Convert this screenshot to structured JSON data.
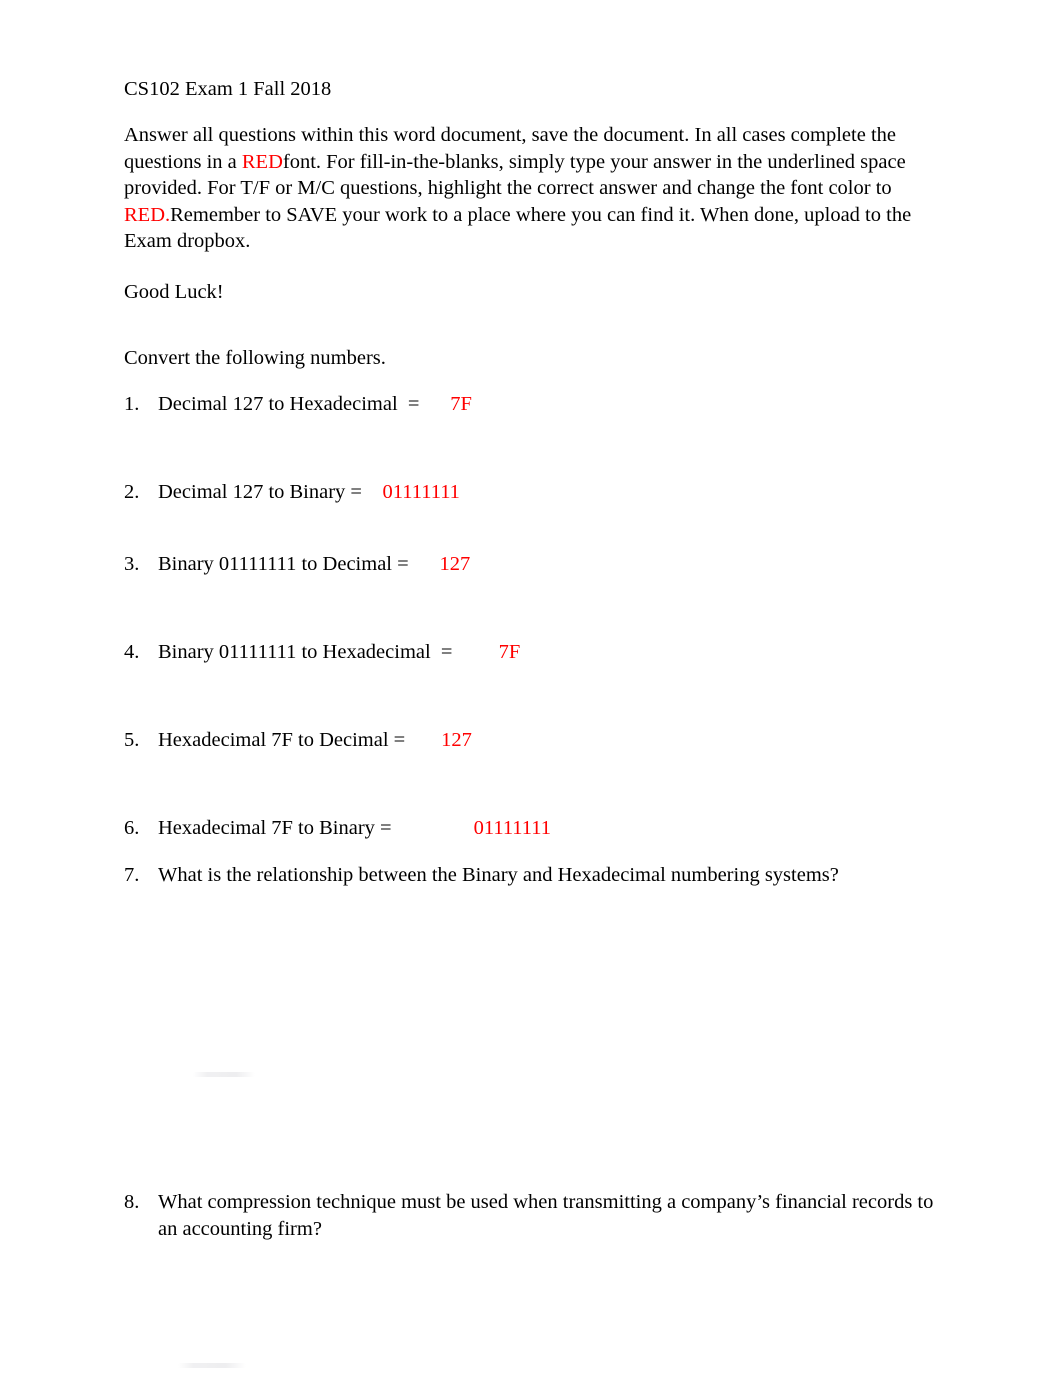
{
  "document": {
    "title": "CS102 Exam 1 Fall 2018",
    "intro": {
      "part1": "Answer all questions within this word document, save the document.    In all cases complete the questions in a ",
      "red1": "RED",
      "part2": "font. For fill-in-the-blanks, simply type your answer in the underlined space provided. For T/F or M/C questions, highlight the correct answer and change the font color to  ",
      "red2": "RED.",
      "part3": "Remember to SAVE your work to a place where you can find it. When done, upload to the Exam dropbox."
    },
    "good_luck": "Good Luck!",
    "section_heading": "Convert the following numbers.",
    "questions": [
      {
        "number": "1.",
        "prompt": "Decimal 127 to Hexadecimal  =",
        "answer": "7F",
        "answer_gap": "      "
      },
      {
        "number": "2.",
        "prompt": "Decimal 127 to Binary =",
        "answer": "01111111",
        "answer_gap": "    "
      },
      {
        "number": "3.",
        "prompt": "Binary 01111111 to Decimal =",
        "answer": "127",
        "answer_gap": "      "
      },
      {
        "number": "4.",
        "prompt": "Binary 01111111 to Hexadecimal  =",
        "answer": "7F",
        "answer_gap": "         "
      },
      {
        "number": "5.",
        "prompt": "Hexadecimal 7F to Decimal =",
        "answer": "127",
        "answer_gap": "       "
      },
      {
        "number": "6.",
        "prompt": "Hexadecimal 7F to Binary =",
        "answer": "01111111",
        "answer_gap": "                "
      },
      {
        "number": "7.",
        "prompt": "What is the relationship between the Binary and Hexadecimal numbering systems?",
        "answer": "",
        "answer_gap": ""
      },
      {
        "number": "8.",
        "prompt": "What compression technique must be used when transmitting a company’s financial records to an accounting firm?",
        "answer": "",
        "answer_gap": ""
      }
    ],
    "colors": {
      "answer_red": "#ff0000",
      "body_text": "#000000",
      "page_background": "#ffffff"
    }
  }
}
